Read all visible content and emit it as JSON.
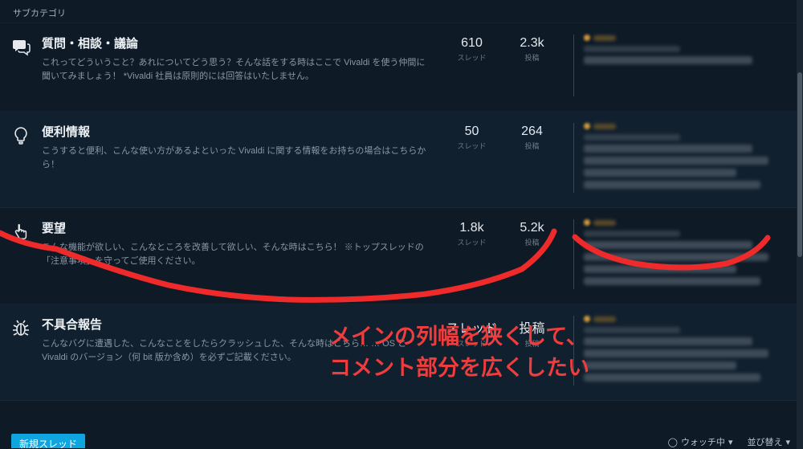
{
  "subcategory_label": "サブカテゴリ",
  "stat_labels": {
    "threads": "スレッド",
    "posts": "投稿"
  },
  "categories": [
    {
      "iconkey": "chat",
      "title": "質問・相談・議論",
      "desc": "これってどういうこと？あれについてどう思う？そんな話をする時はここで Vivaldi を使う仲間に聞いてみましょう！ *Vivaldi 社員は原則的には回答はいたしません。",
      "threads": "610",
      "posts": "2.3k"
    },
    {
      "iconkey": "bulb",
      "title": "便利情報",
      "desc": "こうすると便利、こんな使い方があるよといった Vivaldi に関する情報をお持ちの場合はこちらから！",
      "threads": "50",
      "posts": "264"
    },
    {
      "iconkey": "pointer",
      "title": "要望",
      "desc": "こんな機能が欲しい、こんなところを改善して欲しい、そんな時はこちら！ ※トップスレッドの「注意事項」を守ってご使用ください。",
      "threads": "1.8k",
      "posts": "5.2k"
    },
    {
      "iconkey": "bug",
      "title": "不具合報告",
      "desc": "こんなバグに遭遇した、こんなことをしたらクラッシュした、そんな時はこちら… … OS と Vivaldi のバージョン（何 bit 版か含め）を必ずご記載ください。",
      "threads": "スレッド",
      "posts": "投稿"
    }
  ],
  "annotation": {
    "line1": "メインの列幅を狭くして、",
    "line2": "コメント部分を広くしたい"
  },
  "bottom": {
    "new_thread": "新規スレッド",
    "watching": "ウォッチ中",
    "sort": "並び替え"
  }
}
